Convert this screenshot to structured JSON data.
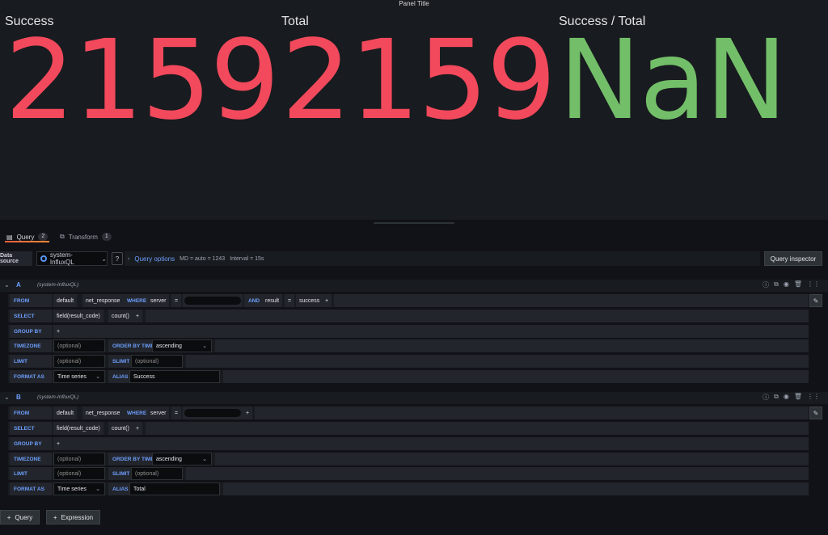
{
  "panel": {
    "title": "Panel Title",
    "stats": [
      {
        "label": "Success",
        "value": "2159",
        "color": "#f2495c"
      },
      {
        "label": "Total",
        "value": "2159",
        "color": "#f2495c"
      },
      {
        "label": "Success / Total",
        "value": "NaN",
        "color": "#73bf69"
      }
    ]
  },
  "tabs": [
    {
      "label": "Query",
      "count": "2",
      "icon": "database-icon"
    },
    {
      "label": "Transform",
      "count": "1",
      "icon": "transform-icon"
    }
  ],
  "datasource": {
    "label": "Data source",
    "selected": "system-InfluxQL",
    "query_options_label": "Query options",
    "md": "MD = auto = 1243",
    "interval": "Interval = 15s",
    "inspector_label": "Query inspector"
  },
  "queries": [
    {
      "letter": "A",
      "datasource": "(system-InfluxQL)",
      "from": {
        "kw": "FROM",
        "policy": "default",
        "measurement": "net_response",
        "where_kw": "WHERE",
        "tag1": "server",
        "op1": "=",
        "and_kw": "AND",
        "tag2": "result",
        "op2": "=",
        "val2": "success",
        "plus": "+"
      },
      "select": {
        "kw": "SELECT",
        "field": "field(result_code)",
        "fn": "count()",
        "plus": "+"
      },
      "groupby": {
        "kw": "GROUP BY",
        "plus": "+"
      },
      "timezone": {
        "kw": "TIMEZONE",
        "placeholder": "(optional)",
        "order_kw": "ORDER BY TIME",
        "order": "ascending"
      },
      "limit": {
        "kw": "LIMIT",
        "placeholder": "(optional)",
        "slimit_kw": "SLIMIT",
        "slimit_placeholder": "(optional)"
      },
      "format": {
        "kw": "FORMAT AS",
        "value": "Time series",
        "alias_kw": "ALIAS",
        "alias": "Success"
      }
    },
    {
      "letter": "B",
      "datasource": "(system-InfluxQL)",
      "from": {
        "kw": "FROM",
        "policy": "default",
        "measurement": "net_response",
        "where_kw": "WHERE",
        "tag1": "server",
        "op1": "=",
        "plus": "+"
      },
      "select": {
        "kw": "SELECT",
        "field": "field(result_code)",
        "fn": "count()",
        "plus": "+"
      },
      "groupby": {
        "kw": "GROUP BY",
        "plus": "+"
      },
      "timezone": {
        "kw": "TIMEZONE",
        "placeholder": "(optional)",
        "order_kw": "ORDER BY TIME",
        "order": "ascending"
      },
      "limit": {
        "kw": "LIMIT",
        "placeholder": "(optional)",
        "slimit_kw": "SLIMIT",
        "slimit_placeholder": "(optional)"
      },
      "format": {
        "kw": "FORMAT AS",
        "value": "Time series",
        "alias_kw": "ALIAS",
        "alias": "Total"
      }
    }
  ],
  "footer": {
    "add_query": "Query",
    "add_expression": "Expression"
  }
}
